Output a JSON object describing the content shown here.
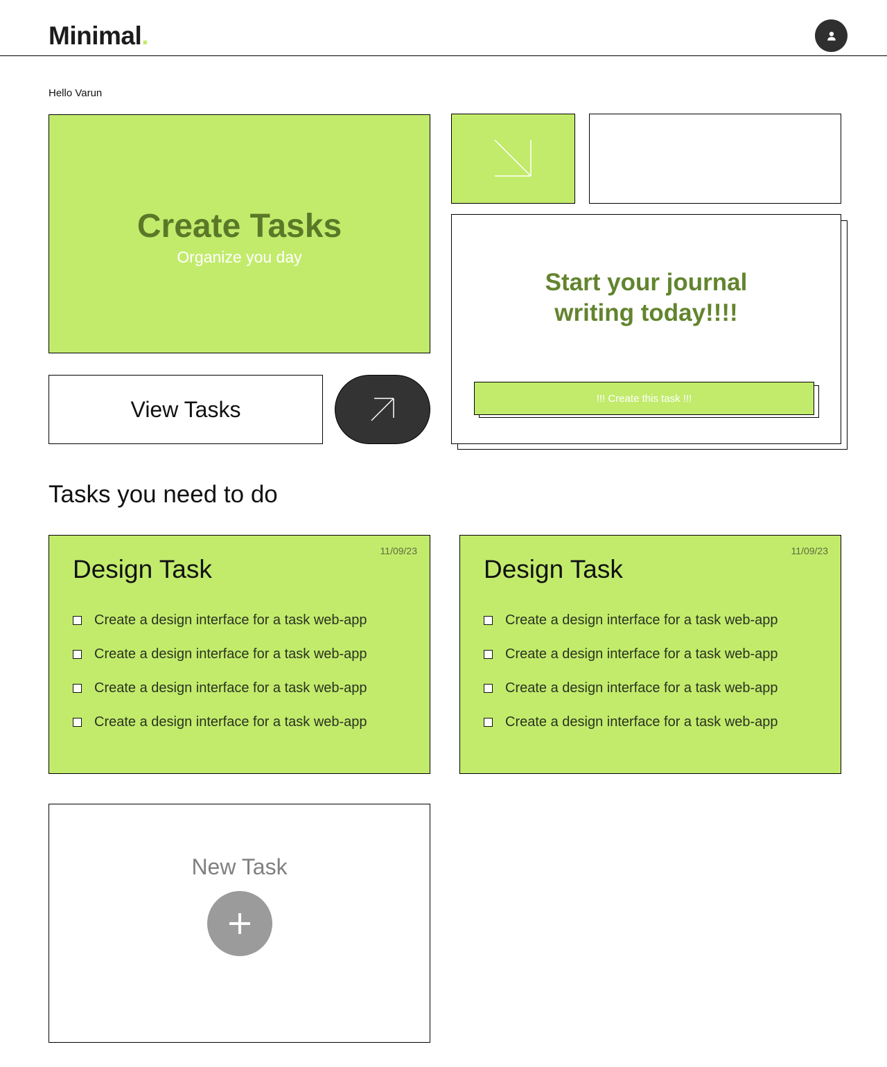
{
  "app": {
    "logo_text": "Minimal",
    "logo_dot": ".",
    "avatar_icon": "user-icon",
    "accent_color": "#c2eb6c",
    "dark_color": "#333333"
  },
  "greeting": "Hello Varun",
  "create_card": {
    "title": "Create Tasks",
    "subtitle": "Organize you day"
  },
  "arrow_card": {
    "icon": "arrow-down-right-icon"
  },
  "view_tasks": {
    "label": "View Tasks",
    "go_icon": "arrow-up-right-icon"
  },
  "journal": {
    "title_line1": "Start your journal",
    "title_line2": "writing today!!!!",
    "button_label": "!!! Create this task !!!"
  },
  "section_title": "Tasks you need to do",
  "tasks": [
    {
      "title": "Design Task",
      "date": "11/09/23",
      "items": [
        "Create a design interface for a task web-app",
        "Create a design interface for a task web-app",
        "Create a design interface for a task web-app",
        "Create a design interface for a task web-app"
      ]
    },
    {
      "title": "Design Task",
      "date": "11/09/23",
      "items": [
        "Create a design interface for a task web-app",
        "Create a design interface for a task web-app",
        "Create a design interface for a task web-app",
        "Create a design interface for a task web-app"
      ]
    }
  ],
  "new_task": {
    "label": "New Task",
    "icon": "plus-icon"
  }
}
